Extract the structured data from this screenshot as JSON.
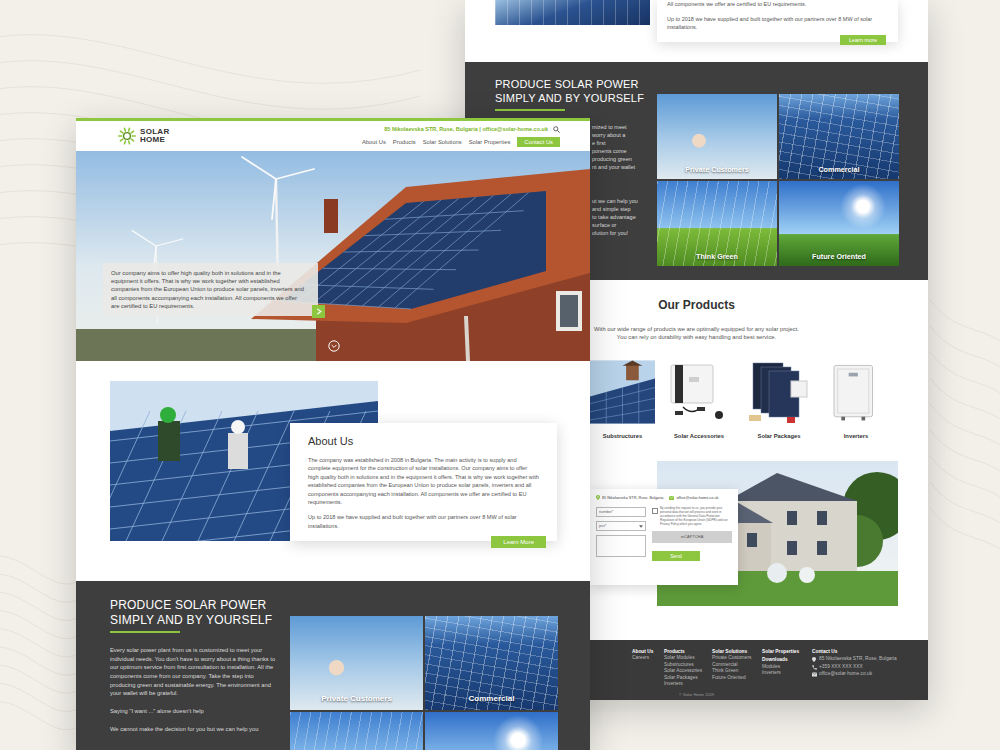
{
  "front_page": {
    "logo": {
      "line1": "SOLAR",
      "line2": "HOME"
    },
    "contact_line": "85 Nikolaevska STR, Ruse, Bulgaria | office@solar-home.co.uk",
    "nav": [
      {
        "label": "About Us",
        "kind": "link"
      },
      {
        "label": "Products",
        "kind": "link"
      },
      {
        "label": "Solar Solutions",
        "kind": "link"
      },
      {
        "label": "Solar Properties",
        "kind": "link"
      },
      {
        "label": "Contact Us",
        "kind": "button"
      }
    ],
    "hero": {
      "text": "Our company aims to offer high quality both in solutions and in the equipment it offers. That is why we work together with established companies from the European Union to produce solar panels, inverters and all components accompanying each installation. All components we offer are certified to EU requirements."
    },
    "about": {
      "title": "About Us",
      "paragraphs": [
        "The company was established in 2008 in Bulgaria. The main activity is to supply and complete equipment for the construction of solar installations. Our company aims to offer high quality both in solutions and in the equipment it offers. That is why we work together with established companies from the European Union to produce solar panels, inverters and all components accompanying each installation. All components we offer are certified to EU requirements.",
        "Up to 2018 we have supplied and built together with our partners over 8 MW of solar installations."
      ],
      "button": "Learn More"
    },
    "produce": {
      "title": [
        "PRODUCE SOLAR POWER",
        "SIMPLY AND BY YOURSELF"
      ],
      "paragraphs": [
        "Every solar power plant from us is customized to meet your individual needs. You don't have to worry about a thing thanks to our optimum service from first consultation to installation. All the components come from our company.  Take the step into producing green and sustainable energy. The environment and your wallet will be grateful.",
        "Saying \"I want ...\" alone doesn't help",
        "We cannot make the decision for you but we can help you"
      ],
      "tiles": [
        {
          "label": "Private Customers"
        },
        {
          "label": "Commercial"
        }
      ]
    }
  },
  "back_page": {
    "intro": {
      "paragraphs": [
        "All components we offer are certified to EU requirements.",
        "Up to 2018 we have supplied and built together with our partners over 8 MW of solar installations."
      ],
      "button": "Learn more"
    },
    "produce": {
      "title": [
        "PRODUCE SOLAR POWER",
        "SIMPLY AND BY YOURSELF"
      ],
      "paragraphs": [
        [
          "mized to meet",
          "worry about a",
          "e first",
          "ponents come",
          "producing green",
          "nt and your wallet"
        ],
        [
          "ut we can help you",
          "and simple step",
          "to take advantage",
          "surface or",
          "olution for you!"
        ]
      ],
      "tiles": [
        {
          "label": "Private Customers"
        },
        {
          "label": "Commercial"
        },
        {
          "label": "Think Green"
        },
        {
          "label": "Future Oriented"
        }
      ]
    },
    "products": {
      "title": "Our Products",
      "subtitle": [
        "With our wide range of products we are optimally equipped for any solar project.",
        "You can rely on durability with easy handling and best service."
      ],
      "items": [
        {
          "label": "Substructures",
          "kind": "photo"
        },
        {
          "label": "Solar Accessories",
          "kind": "accessories"
        },
        {
          "label": "Solar Packages",
          "kind": "panels"
        },
        {
          "label": "Inverters",
          "kind": "inverter"
        }
      ]
    },
    "contact_form": {
      "address": "85 Nikolaevska STR, Ruse, Bulgaria",
      "email": "office@solar-home.co.uk",
      "fields": [
        {
          "placeholder": "number*",
          "kind": "input"
        },
        {
          "placeholder": "ject*",
          "kind": "select"
        }
      ],
      "consent": {
        "text": "By sending this request to us, you provide your personal data that we will process and store in accordance with the General Data Protection Regulation of the European Union (GDPR) and our Privacy Policy which you agree.",
        "checked": false
      },
      "captcha": "reCAPTCHA",
      "button": "Send"
    },
    "footer": {
      "columns": [
        {
          "groups": [
            {
              "title": "About Us",
              "items": [
                "Careers"
              ]
            }
          ]
        },
        {
          "groups": [
            {
              "title": "Products",
              "items": [
                "Solar Modules",
                "Substructures",
                "Solar Accessories",
                "Solar Packages",
                "Inverters"
              ]
            }
          ]
        },
        {
          "groups": [
            {
              "title": "Solar Solutions",
              "items": [
                "Private Customers",
                "Commercial",
                "Think Green",
                "Future Oriented"
              ]
            }
          ]
        },
        {
          "groups": [
            {
              "title": "Solar Properties",
              "items": []
            },
            {
              "title": "Downloads",
              "items": [
                "Modules",
                "Inverters"
              ]
            }
          ]
        }
      ],
      "contact": {
        "title": "Contact Us",
        "entries": [
          {
            "text": "85 Nikolaevska STR, Ruse, Bulgaria",
            "kind": "address"
          },
          {
            "text": "+359 XXX XXX XXX",
            "kind": "phone"
          },
          {
            "text": "office@solar-home.co.uk",
            "kind": "email"
          }
        ]
      },
      "copyright": "© Solar Home 2019"
    }
  }
}
